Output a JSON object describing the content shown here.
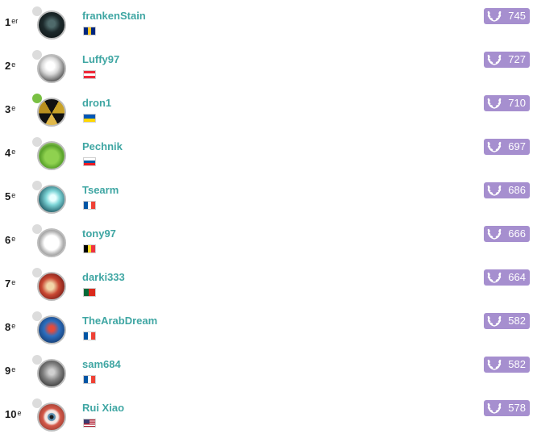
{
  "colors": {
    "name": "#3fa6a3",
    "badge": "#a68fcf",
    "online_dot": "#79c043",
    "offline_dot": "#dcdcdc"
  },
  "icons": {
    "score": "laurel-wreath-icon",
    "status": "status-dot"
  },
  "rows": [
    {
      "rank": "1",
      "suffix": "er",
      "name": "frankenStain",
      "score": "745",
      "online": false,
      "flag": "barbados-flag",
      "avatar": "avatar-dark-cat"
    },
    {
      "rank": "2",
      "suffix": "e",
      "name": "Luffy97",
      "score": "727",
      "online": false,
      "flag": "austria-flag",
      "avatar": "avatar-anime-character"
    },
    {
      "rank": "3",
      "suffix": "e",
      "name": "dron1",
      "score": "710",
      "online": true,
      "flag": "ukraine-flag",
      "avatar": "avatar-gold-triangle"
    },
    {
      "rank": "4",
      "suffix": "e",
      "name": "Pechnik",
      "score": "697",
      "online": false,
      "flag": "slovenia-flag",
      "avatar": "avatar-green-frog"
    },
    {
      "rank": "5",
      "suffix": "e",
      "name": "Tsearm",
      "score": "686",
      "online": false,
      "flag": "france-flag",
      "avatar": "avatar-cyan-blur"
    },
    {
      "rank": "6",
      "suffix": "e",
      "name": "tony97",
      "score": "666",
      "online": false,
      "flag": "belgium-flag",
      "avatar": "avatar-troll-face"
    },
    {
      "rank": "7",
      "suffix": "e",
      "name": "darki333",
      "score": "664",
      "online": false,
      "flag": "portugal-flag",
      "avatar": "avatar-red-art"
    },
    {
      "rank": "8",
      "suffix": "e",
      "name": "TheArabDream",
      "score": "582",
      "online": false,
      "flag": "france-flag",
      "avatar": "avatar-blue-comic"
    },
    {
      "rank": "9",
      "suffix": "e",
      "name": "sam684",
      "score": "582",
      "online": false,
      "flag": "france-flag",
      "avatar": "avatar-grey-warrior"
    },
    {
      "rank": "10",
      "suffix": "e",
      "name": "Rui Xiao",
      "score": "578",
      "online": false,
      "flag": "usa-flag",
      "avatar": "avatar-red-eye"
    }
  ]
}
